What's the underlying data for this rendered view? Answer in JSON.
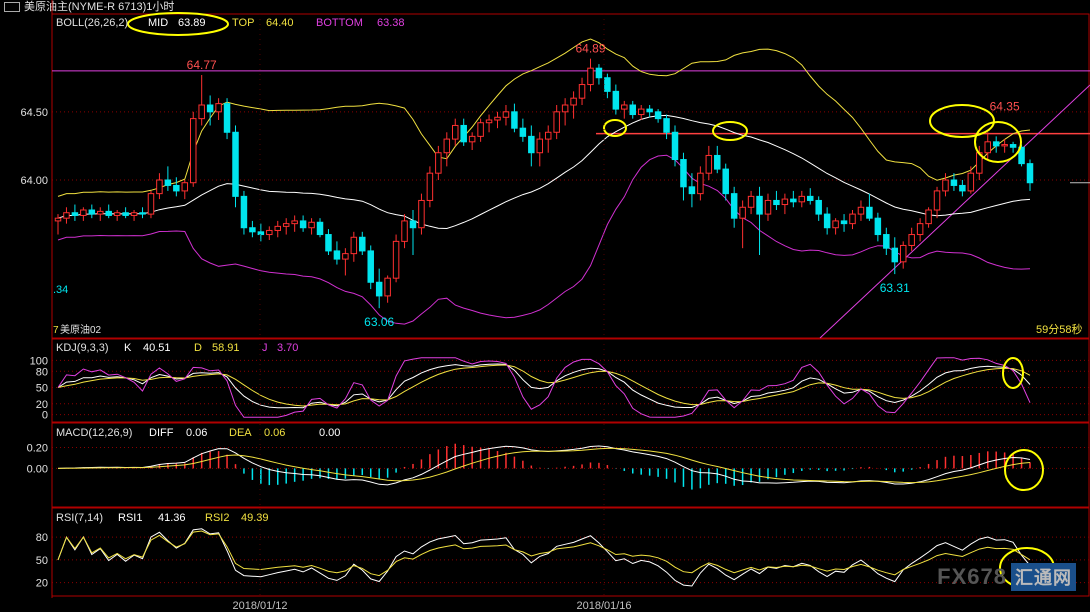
{
  "window": {
    "title": "美原油主(NYME-R 6713)1小时"
  },
  "boll": {
    "label": "BOLL(26,26,2)",
    "mid_label": "MID",
    "mid": "63.89",
    "top_label": "TOP",
    "top": "64.40",
    "bottom_label": "BOTTOM",
    "bottom": "63.38"
  },
  "kdj": {
    "label": "KDJ(9,3,3)",
    "k_label": "K",
    "k": "40.51",
    "d_label": "D",
    "d": "58.91",
    "j_label": "J",
    "j": "3.70"
  },
  "macd": {
    "label": "MACD(12,26,9)",
    "diff_label": "DIFF",
    "diff": "0.06",
    "dea_label": "DEA",
    "dea": "0.06",
    "macd": "0.00"
  },
  "rsi": {
    "label": "RSI(7,14)",
    "rsi1_label": "RSI1",
    "rsi1": "41.36",
    "rsi2_label": "RSI2",
    "rsi2": "49.39"
  },
  "misc": {
    "contract": "美原油02",
    "contract_prefix": "7",
    "countdown": "59分58秒",
    "left_cut": ".34"
  },
  "dates": [
    "2018/01/12",
    "2018/01/16"
  ],
  "annotations": [
    "64.77",
    "64.89",
    "64.35",
    "63.31",
    "63.06"
  ],
  "colors": {
    "up": "#ff3030",
    "down": "#00e5ee",
    "mid": "#ffffff",
    "upper": "#f0e040",
    "lower": "#d030d0",
    "highlight": "#ffff00",
    "grid": "#8b0000"
  },
  "watermark": {
    "brand": "FX678",
    "cn": "汇通网"
  },
  "chart_data": [
    {
      "type": "candlestick",
      "title": "美原油主(NYME-R 6713)1小时",
      "ylabel": "",
      "yticks": [
        64.5,
        64.0
      ],
      "ylim": [
        62.9,
        65.1
      ],
      "ohlc": [
        [
          63.7,
          63.75,
          63.6,
          63.72
        ],
        [
          63.72,
          63.8,
          63.68,
          63.76
        ],
        [
          63.76,
          63.82,
          63.7,
          63.74
        ],
        [
          63.74,
          63.8,
          63.7,
          63.78
        ],
        [
          63.78,
          63.82,
          63.72,
          63.75
        ],
        [
          63.75,
          63.8,
          63.7,
          63.77
        ],
        [
          63.77,
          63.82,
          63.72,
          63.74
        ],
        [
          63.74,
          63.78,
          63.7,
          63.76
        ],
        [
          63.76,
          63.8,
          63.72,
          63.74
        ],
        [
          63.74,
          63.78,
          63.7,
          63.76
        ],
        [
          63.76,
          63.8,
          63.72,
          63.75
        ],
        [
          63.75,
          63.92,
          63.72,
          63.9
        ],
        [
          63.9,
          64.05,
          63.86,
          64.0
        ],
        [
          64.0,
          64.1,
          63.92,
          63.96
        ],
        [
          63.96,
          64.02,
          63.88,
          63.92
        ],
        [
          63.92,
          64.0,
          63.86,
          63.98
        ],
        [
          63.98,
          64.5,
          63.95,
          64.45
        ],
        [
          64.45,
          64.77,
          64.4,
          64.55
        ],
        [
          64.55,
          64.62,
          64.4,
          64.5
        ],
        [
          64.5,
          64.6,
          64.44,
          64.56
        ],
        [
          64.56,
          64.6,
          64.3,
          64.35
        ],
        [
          64.35,
          64.4,
          63.8,
          63.88
        ],
        [
          63.88,
          63.92,
          63.6,
          63.65
        ],
        [
          63.65,
          63.7,
          63.58,
          63.62
        ],
        [
          63.62,
          63.68,
          63.55,
          63.6
        ],
        [
          63.6,
          63.66,
          63.56,
          63.63
        ],
        [
          63.63,
          63.7,
          63.58,
          63.66
        ],
        [
          63.66,
          63.72,
          63.6,
          63.68
        ],
        [
          63.68,
          63.74,
          63.62,
          63.7
        ],
        [
          63.7,
          63.74,
          63.62,
          63.65
        ],
        [
          63.65,
          63.72,
          63.6,
          63.69
        ],
        [
          63.69,
          63.72,
          63.58,
          63.6
        ],
        [
          63.6,
          63.64,
          63.45,
          63.48
        ],
        [
          63.48,
          63.55,
          63.38,
          63.42
        ],
        [
          63.42,
          63.5,
          63.3,
          63.46
        ],
        [
          63.46,
          63.62,
          63.4,
          63.58
        ],
        [
          63.58,
          63.62,
          63.45,
          63.48
        ],
        [
          63.48,
          63.52,
          63.2,
          63.25
        ],
        [
          63.25,
          63.35,
          63.06,
          63.15
        ],
        [
          63.15,
          63.3,
          63.1,
          63.28
        ],
        [
          63.28,
          63.6,
          63.25,
          63.55
        ],
        [
          63.55,
          63.75,
          63.5,
          63.7
        ],
        [
          63.7,
          63.78,
          63.45,
          63.65
        ],
        [
          63.65,
          63.9,
          63.6,
          63.85
        ],
        [
          63.85,
          64.1,
          63.8,
          64.05
        ],
        [
          64.05,
          64.25,
          64.0,
          64.2
        ],
        [
          64.2,
          64.35,
          64.1,
          64.3
        ],
        [
          64.3,
          64.45,
          64.25,
          64.4
        ],
        [
          64.4,
          64.45,
          64.25,
          64.28
        ],
        [
          64.28,
          64.35,
          64.22,
          64.32
        ],
        [
          64.32,
          64.45,
          64.28,
          64.42
        ],
        [
          64.42,
          64.48,
          64.35,
          64.44
        ],
        [
          64.44,
          64.5,
          64.38,
          64.46
        ],
        [
          64.46,
          64.55,
          64.4,
          64.5
        ],
        [
          64.5,
          64.56,
          64.35,
          64.38
        ],
        [
          64.38,
          64.45,
          64.28,
          64.32
        ],
        [
          64.32,
          64.4,
          64.1,
          64.2
        ],
        [
          64.2,
          64.35,
          64.1,
          64.3
        ],
        [
          64.3,
          64.4,
          64.2,
          64.35
        ],
        [
          64.35,
          64.55,
          64.3,
          64.5
        ],
        [
          64.5,
          64.6,
          64.4,
          64.55
        ],
        [
          64.55,
          64.65,
          64.45,
          64.6
        ],
        [
          64.6,
          64.75,
          64.55,
          64.7
        ],
        [
          64.7,
          64.89,
          64.65,
          64.82
        ],
        [
          64.82,
          64.85,
          64.7,
          64.75
        ],
        [
          64.75,
          64.78,
          64.6,
          64.65
        ],
        [
          64.65,
          64.7,
          64.48,
          64.52
        ],
        [
          64.52,
          64.58,
          64.45,
          64.55
        ],
        [
          64.55,
          64.58,
          64.45,
          64.48
        ],
        [
          64.48,
          64.55,
          64.44,
          64.52
        ],
        [
          64.52,
          64.55,
          64.46,
          64.5
        ],
        [
          64.5,
          64.52,
          64.42,
          64.45
        ],
        [
          64.45,
          64.48,
          64.3,
          64.35
        ],
        [
          64.35,
          64.4,
          64.1,
          64.15
        ],
        [
          64.15,
          64.2,
          63.85,
          63.95
        ],
        [
          63.95,
          64.05,
          63.8,
          63.9
        ],
        [
          63.9,
          64.1,
          63.85,
          64.05
        ],
        [
          64.05,
          64.25,
          64.0,
          64.18
        ],
        [
          64.18,
          64.25,
          64.05,
          64.08
        ],
        [
          64.08,
          64.12,
          63.85,
          63.9
        ],
        [
          63.9,
          63.95,
          63.65,
          63.72
        ],
        [
          63.72,
          63.85,
          63.5,
          63.8
        ],
        [
          63.8,
          63.92,
          63.75,
          63.88
        ],
        [
          63.88,
          63.95,
          63.45,
          63.75
        ],
        [
          63.75,
          63.9,
          63.7,
          63.85
        ],
        [
          63.85,
          63.92,
          63.78,
          63.82
        ],
        [
          63.82,
          63.9,
          63.75,
          63.86
        ],
        [
          63.86,
          63.92,
          63.8,
          63.84
        ],
        [
          63.84,
          63.92,
          63.8,
          63.88
        ],
        [
          63.88,
          63.94,
          63.82,
          63.85
        ],
        [
          63.85,
          63.88,
          63.7,
          63.75
        ],
        [
          63.75,
          63.8,
          63.6,
          63.65
        ],
        [
          63.65,
          63.72,
          63.6,
          63.7
        ],
        [
          63.7,
          63.75,
          63.62,
          63.68
        ],
        [
          63.68,
          63.78,
          63.64,
          63.75
        ],
        [
          63.75,
          63.85,
          63.7,
          63.8
        ],
        [
          63.8,
          63.9,
          63.7,
          63.72
        ],
        [
          63.72,
          63.76,
          63.55,
          63.6
        ],
        [
          63.6,
          63.65,
          63.45,
          63.5
        ],
        [
          63.5,
          63.58,
          63.31,
          63.4
        ],
        [
          63.4,
          63.55,
          63.35,
          63.52
        ],
        [
          63.52,
          63.65,
          63.48,
          63.6
        ],
        [
          63.6,
          63.72,
          63.55,
          63.68
        ],
        [
          63.68,
          63.8,
          63.65,
          63.78
        ],
        [
          63.78,
          63.95,
          63.72,
          63.92
        ],
        [
          63.92,
          64.05,
          63.88,
          64.0
        ],
        [
          64.0,
          64.05,
          63.92,
          63.96
        ],
        [
          63.96,
          64.0,
          63.88,
          63.92
        ],
        [
          63.92,
          64.1,
          63.9,
          64.05
        ],
        [
          64.05,
          64.25,
          64.0,
          64.2
        ],
        [
          64.2,
          64.35,
          64.15,
          64.28
        ],
        [
          64.28,
          64.32,
          64.2,
          64.25
        ],
        [
          64.25,
          64.3,
          64.2,
          64.26
        ],
        [
          64.26,
          64.28,
          64.2,
          64.24
        ],
        [
          64.24,
          64.26,
          64.1,
          64.12
        ],
        [
          64.12,
          64.15,
          63.92,
          63.98
        ]
      ]
    },
    {
      "type": "line",
      "title": "KDJ(9,3,3)",
      "yticks": [
        100,
        80,
        50,
        20,
        0
      ],
      "ylim": [
        -10,
        110
      ]
    },
    {
      "type": "bar",
      "title": "MACD(12,26,9)",
      "yticks": [
        0.2,
        0.0
      ],
      "ylim": [
        -0.35,
        0.3
      ]
    },
    {
      "type": "line",
      "title": "RSI(7,14)",
      "yticks": [
        80,
        50,
        20
      ],
      "ylim": [
        5,
        100
      ]
    }
  ]
}
